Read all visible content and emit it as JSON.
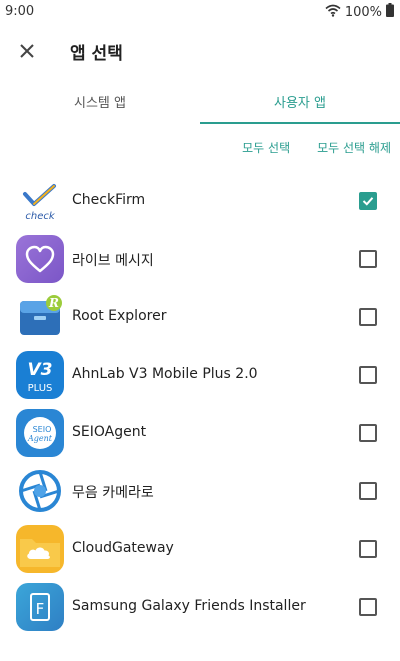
{
  "status": {
    "time": "9:00",
    "battery": "100%"
  },
  "header": {
    "title": "앱 선택"
  },
  "tabs": [
    {
      "label": "시스템 앱"
    },
    {
      "label": "사용자 앱"
    }
  ],
  "actions": {
    "select_all": "모두 선택",
    "deselect_all": "모두 선택 해제"
  },
  "apps": [
    {
      "name": "CheckFirm",
      "icon": "checkfirm-icon",
      "icon_text": "check",
      "checked": true
    },
    {
      "name": "라이브 메시지",
      "icon": "live-message-icon",
      "checked": false
    },
    {
      "name": "Root Explorer",
      "icon": "root-explorer-icon",
      "icon_text": "R",
      "checked": false
    },
    {
      "name": "AhnLab V3 Mobile Plus 2.0",
      "icon": "ahnlab-v3-icon",
      "icon_text": "V3",
      "icon_text2": "PLUS",
      "checked": false
    },
    {
      "name": "SEIOAgent",
      "icon": "seioagent-icon",
      "icon_text": "SEIO",
      "icon_text2": "Agent",
      "checked": false
    },
    {
      "name": "무음 카메라로",
      "icon": "silent-camera-icon",
      "checked": false
    },
    {
      "name": "CloudGateway",
      "icon": "cloud-gateway-icon",
      "checked": false
    },
    {
      "name": "Samsung Galaxy Friends Installer",
      "icon": "galaxy-friends-icon",
      "icon_text": "F",
      "checked": false
    }
  ],
  "colors": {
    "accent": "#2a9d8f"
  }
}
